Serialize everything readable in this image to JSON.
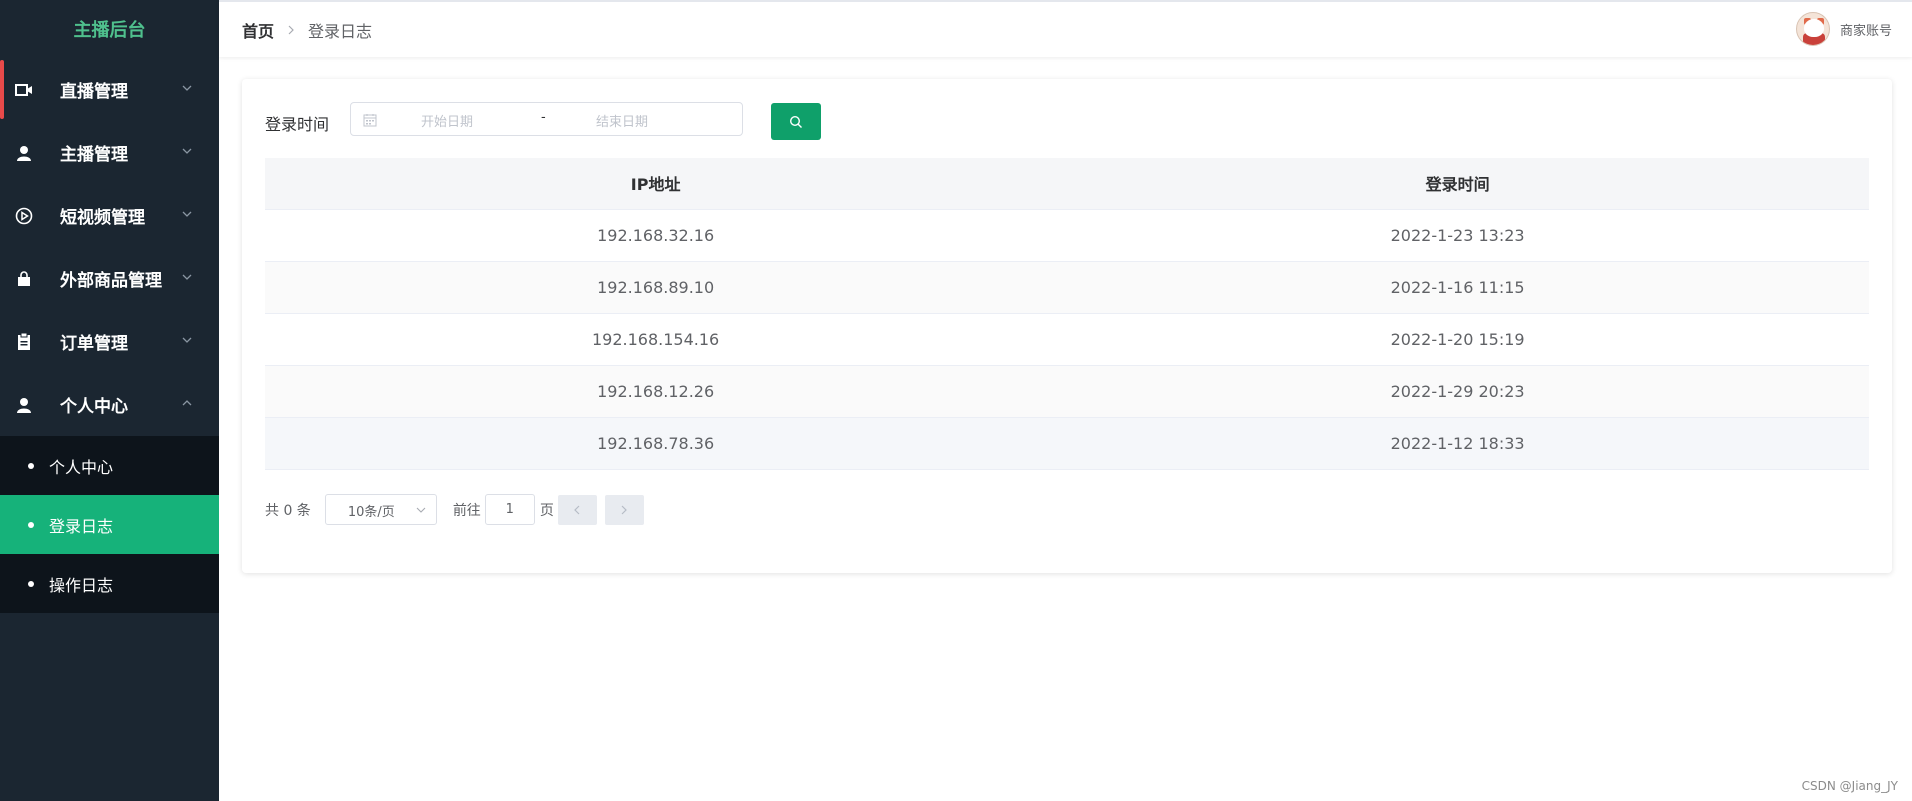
{
  "sidebar": {
    "brand": "主播后台",
    "items": [
      {
        "label": "直播管理",
        "icon": "video-camera-icon"
      },
      {
        "label": "主播管理",
        "icon": "user-icon"
      },
      {
        "label": "短视频管理",
        "icon": "play-circle-icon"
      },
      {
        "label": "外部商品管理",
        "icon": "shopping-bag-icon"
      },
      {
        "label": "订单管理",
        "icon": "clipboard-icon"
      },
      {
        "label": "个人中心",
        "icon": "user-icon",
        "expanded": true
      }
    ],
    "submenu": [
      {
        "label": "个人中心"
      },
      {
        "label": "登录日志",
        "active": true
      },
      {
        "label": "操作日志"
      }
    ]
  },
  "header": {
    "breadcrumb_home": "首页",
    "breadcrumb_current": "登录日志",
    "account_name": "商家账号"
  },
  "filter": {
    "label": "登录时间",
    "start_placeholder": "开始日期",
    "separator": "-",
    "end_placeholder": "结束日期"
  },
  "table": {
    "columns": [
      "IP地址",
      "登录时间"
    ],
    "rows": [
      [
        "192.168.32.16",
        "2022-1-23 13:23"
      ],
      [
        "192.168.89.10",
        "2022-1-16 11:15"
      ],
      [
        "192.168.154.16",
        "2022-1-20 15:19"
      ],
      [
        "192.168.12.26",
        "2022-1-29 20:23"
      ],
      [
        "192.168.78.36",
        "2022-1-12 18:33"
      ]
    ]
  },
  "pagination": {
    "total": "共 0 条",
    "page_size": "10条/页",
    "goto_label": "前往",
    "current_page": "1",
    "page_unit": "页"
  },
  "watermark": "CSDN @Jiang_JY",
  "colors": {
    "sidebar_bg": "#1b2631",
    "brand_green": "#4fc08d",
    "active_green": "#16b27a",
    "button_green": "#0fa06a",
    "marker_red": "#e84a4a"
  }
}
